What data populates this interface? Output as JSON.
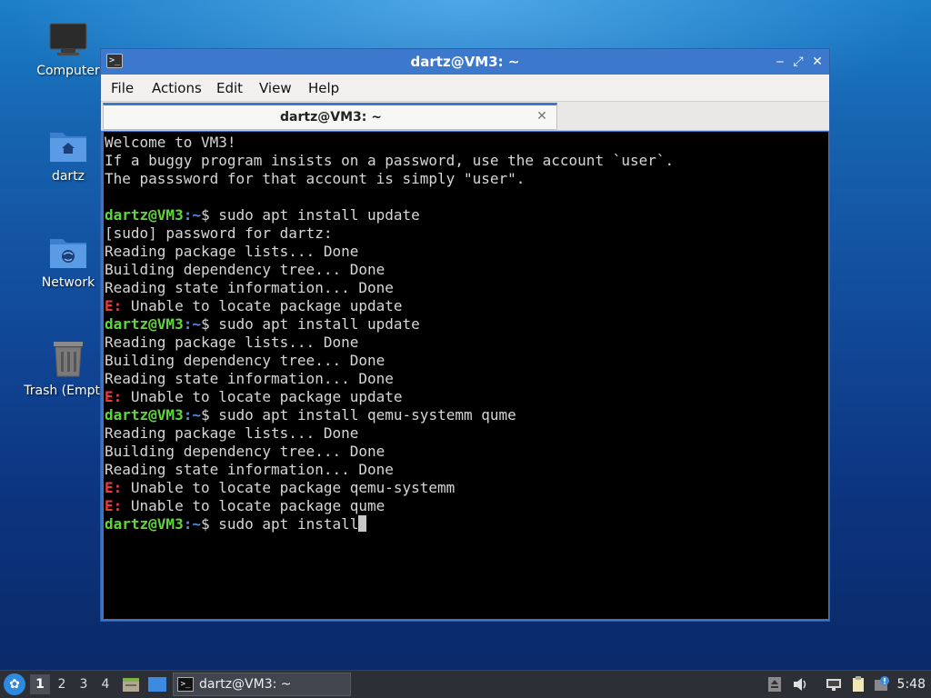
{
  "desktop": {
    "icons": [
      {
        "label": "Computer"
      },
      {
        "label": "dartz"
      },
      {
        "label": "Network"
      },
      {
        "label": "Trash (Empty)"
      }
    ]
  },
  "window": {
    "title": "dartz@VM3: ~",
    "controls": {
      "minimize": "‒",
      "maximize": "⤢",
      "close": "✕"
    },
    "menu": [
      "File",
      "Actions",
      "Edit",
      "View",
      "Help"
    ],
    "tab": {
      "title": "dartz@VM3: ~",
      "close": "✕"
    }
  },
  "terminal": {
    "prompt_user": "dartz@VM3",
    "prompt_sep": ":",
    "prompt_path": "~",
    "prompt_symbol": "$ ",
    "error_tag": "E:",
    "lines": [
      {
        "kind": "text",
        "text": "Welcome to VM3!"
      },
      {
        "kind": "text",
        "text": "If a buggy program insists on a password, use the account `user`."
      },
      {
        "kind": "text",
        "text": "The passsword for that account is simply \"user\"."
      },
      {
        "kind": "text",
        "text": ""
      },
      {
        "kind": "prompt",
        "text": "sudo apt install update"
      },
      {
        "kind": "text",
        "text": "[sudo] password for dartz:"
      },
      {
        "kind": "text",
        "text": "Reading package lists... Done"
      },
      {
        "kind": "text",
        "text": "Building dependency tree... Done"
      },
      {
        "kind": "text",
        "text": "Reading state information... Done"
      },
      {
        "kind": "error",
        "text": " Unable to locate package update"
      },
      {
        "kind": "prompt",
        "text": "sudo apt install update"
      },
      {
        "kind": "text",
        "text": "Reading package lists... Done"
      },
      {
        "kind": "text",
        "text": "Building dependency tree... Done"
      },
      {
        "kind": "text",
        "text": "Reading state information... Done"
      },
      {
        "kind": "error",
        "text": " Unable to locate package update"
      },
      {
        "kind": "prompt",
        "text": "sudo apt install qemu-systemm qume"
      },
      {
        "kind": "text",
        "text": "Reading package lists... Done"
      },
      {
        "kind": "text",
        "text": "Building dependency tree... Done"
      },
      {
        "kind": "text",
        "text": "Reading state information... Done"
      },
      {
        "kind": "error",
        "text": " Unable to locate package qemu-systemm"
      },
      {
        "kind": "error",
        "text": " Unable to locate package qume"
      },
      {
        "kind": "prompt",
        "text": "sudo apt install",
        "cursor": true
      }
    ]
  },
  "taskbar": {
    "workspaces": [
      "1",
      "2",
      "3",
      "4"
    ],
    "active_workspace": "1",
    "task_label": "dartz@VM3: ~",
    "clock": "5:48"
  },
  "colors": {
    "prompt_user": "#5fd738",
    "prompt_path": "#4f8ee6",
    "error": "#ee3a3a",
    "titlebar": "#3c78cc"
  }
}
